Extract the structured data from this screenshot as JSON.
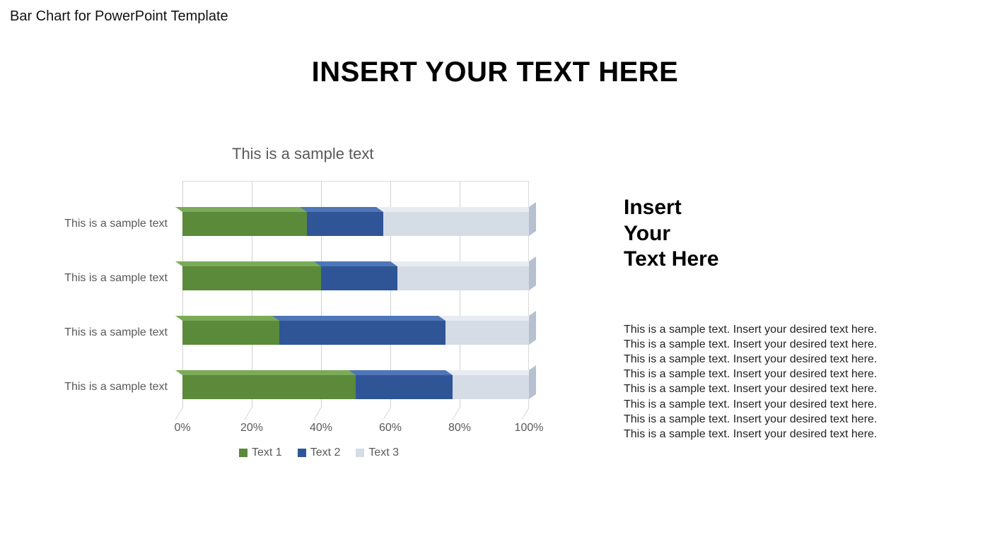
{
  "page_caption": "Bar Chart for PowerPoint Template",
  "slide_title": "INSERT YOUR TEXT HERE",
  "chart_data": {
    "type": "bar",
    "orientation": "horizontal_stacked_100",
    "title": "This is a sample text",
    "categories": [
      "This is a sample text",
      "This is a sample text",
      "This is a sample text",
      "This is a sample text"
    ],
    "series": [
      {
        "name": "Text 1",
        "color": "#5a8a3a",
        "values": [
          36,
          40,
          28,
          50
        ]
      },
      {
        "name": "Text 2",
        "color": "#2f5597",
        "values": [
          22,
          22,
          48,
          28
        ]
      },
      {
        "name": "Text 3",
        "color": "#d6dce5",
        "values": [
          42,
          38,
          24,
          22
        ]
      }
    ],
    "x_ticks": [
      "0%",
      "20%",
      "40%",
      "60%",
      "80%",
      "100%"
    ],
    "xlim": [
      0,
      100
    ],
    "xlabel": "",
    "ylabel": ""
  },
  "side_heading_l1": "Insert",
  "side_heading_l2": "Your",
  "side_heading_l3": "Text Here",
  "side_body_lines": [
    "This is a sample text. Insert your desired text here.",
    "This is a sample text. Insert your desired text here.",
    "This is a sample text. Insert your desired text here.",
    "This is a sample text. Insert your desired text here.",
    "This is a sample text. Insert your desired text here.",
    "This is a sample text. Insert your desired text here.",
    "This is a sample text. Insert your desired text here.",
    "This is a sample text. Insert your desired text here."
  ]
}
